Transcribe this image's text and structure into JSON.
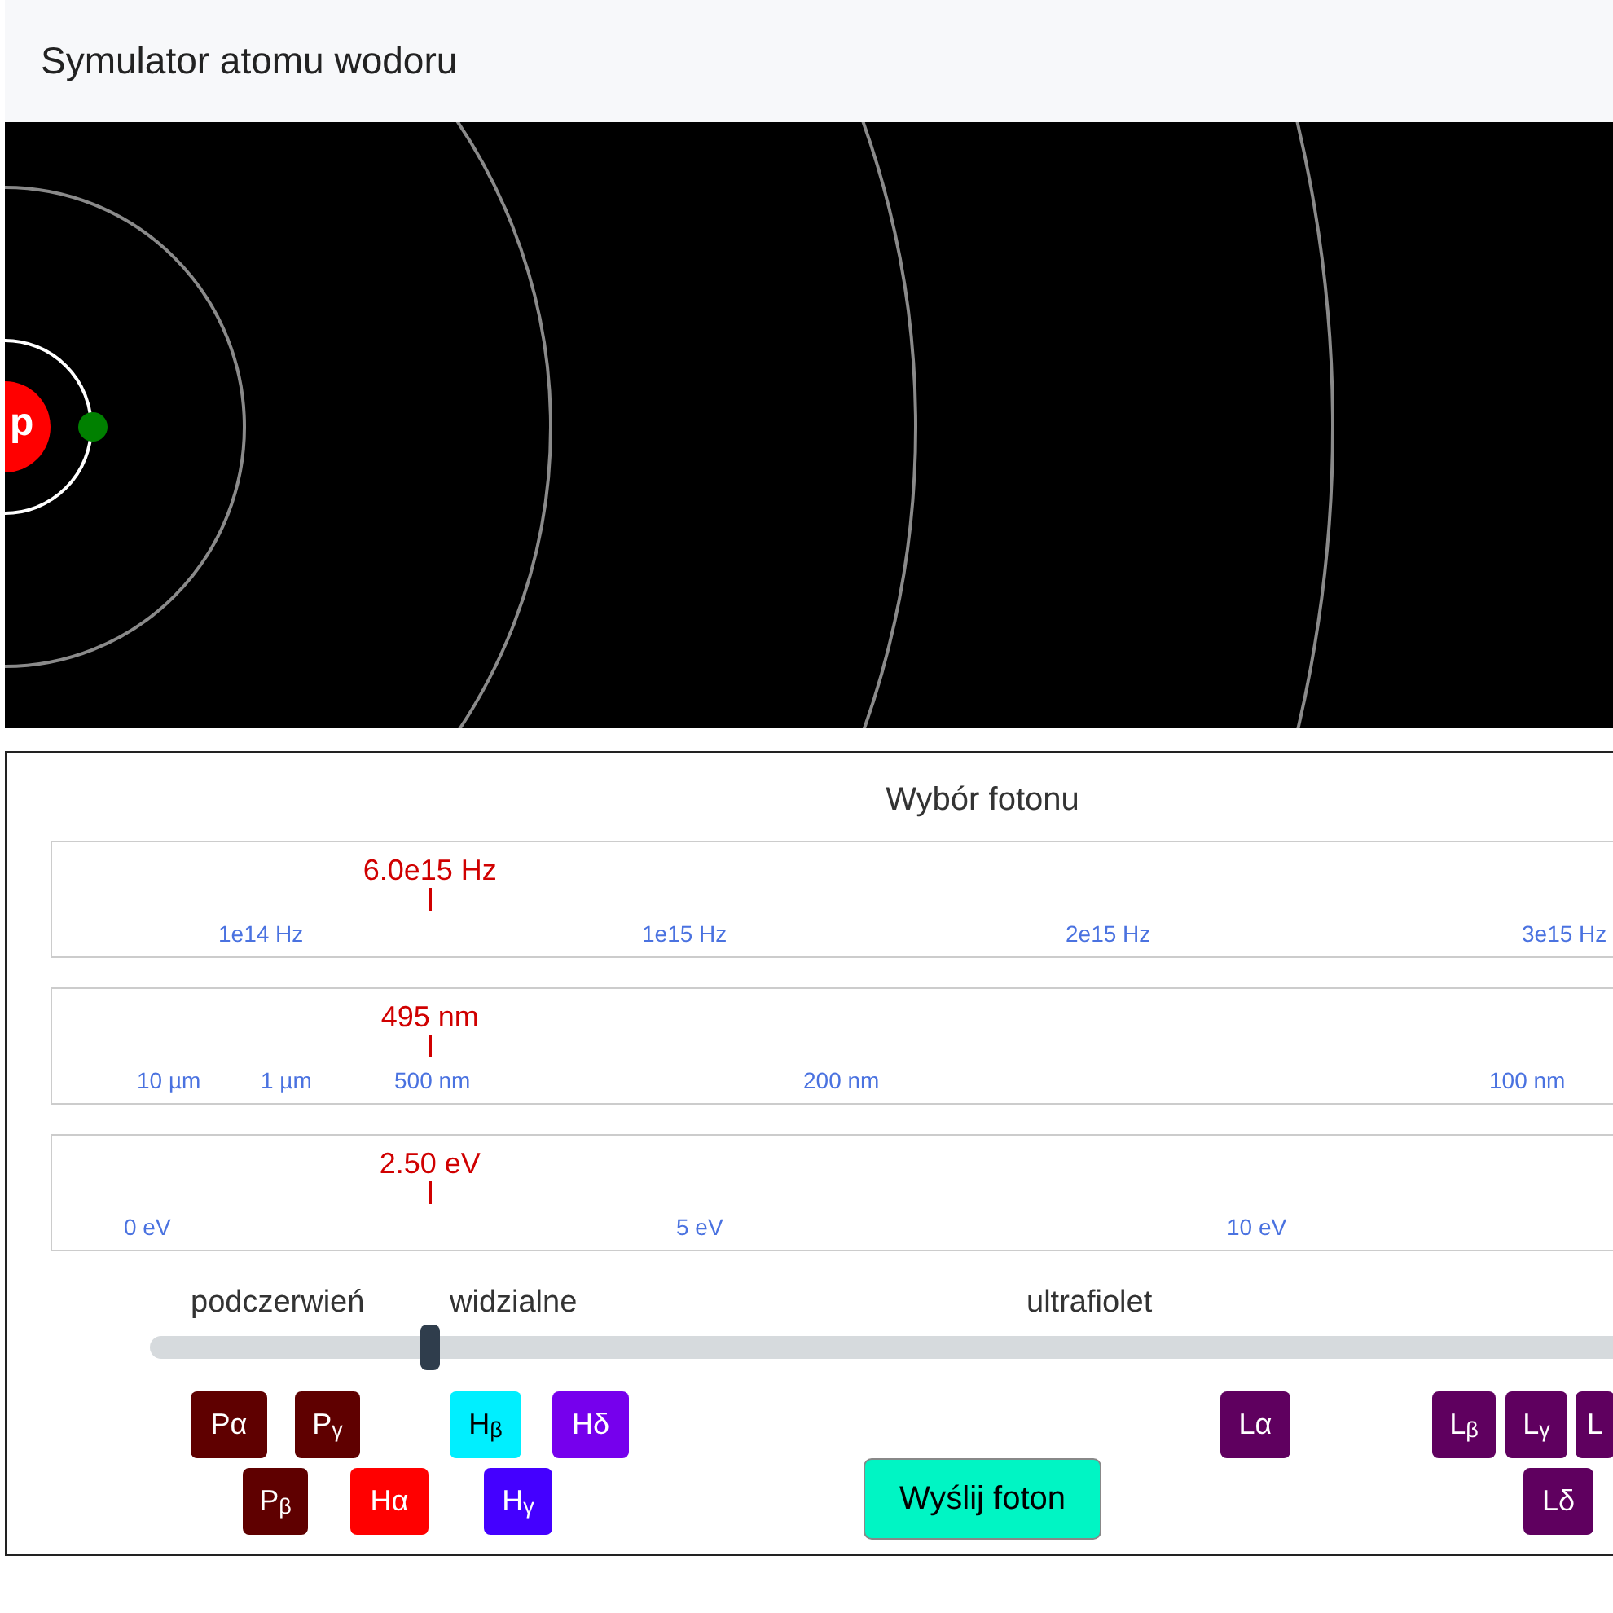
{
  "header": {
    "title": "Symulator atomu wodoru"
  },
  "atom": {
    "nucleus": "p"
  },
  "panel": {
    "title": "Wybór fotonu",
    "scales": [
      {
        "reading": "6.0e15 Hz",
        "ticks": [
          "1e14 Hz",
          "1e15 Hz",
          "2e15 Hz",
          "3e15 Hz"
        ]
      },
      {
        "reading": "495 nm",
        "ticks": [
          "10 µm",
          "1 µm",
          "500 nm",
          "200 nm",
          "100 nm"
        ]
      },
      {
        "reading": "2.50 eV",
        "ticks": [
          "0 eV",
          "5 eV",
          "10 eV"
        ]
      }
    ],
    "regions": [
      "podczerwień",
      "widzialne",
      "ultrafiolet"
    ],
    "slider": {
      "level": 0.158
    },
    "photons": [
      {
        "label": "Pα",
        "color": "#5f0000"
      },
      {
        "label": "P$_{γ}$",
        "color": "#5f0000"
      },
      {
        "label": "P$_{β}$",
        "color": "#5f0000"
      },
      {
        "label": "Hα",
        "color": "#ff0000"
      },
      {
        "label": "H$_{β}$",
        "color": "#00efff"
      },
      {
        "label": "H$_{γ}$",
        "color": "#4400ff"
      },
      {
        "label": "Hδ",
        "color": "#7600ed"
      },
      {
        "label": "Lα",
        "color": "#5f005f"
      },
      {
        "label": "L$_{β}$",
        "color": "#5f005f"
      },
      {
        "label": "L$_{γ}$",
        "color": "#5f005f"
      },
      {
        "label": "L",
        "color": "#5f005f"
      },
      {
        "label": "Lδ",
        "color": "#5f005f"
      }
    ],
    "send_button": "Wyślij foton"
  }
}
